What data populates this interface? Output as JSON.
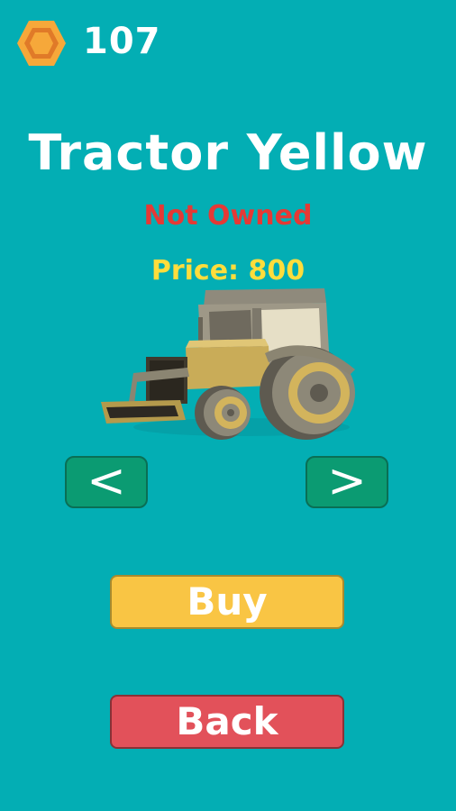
{
  "currency": {
    "icon": "hexagon-coin-icon",
    "amount": "107",
    "colors": {
      "outer": "#f6a83a",
      "inner": "#e07a28"
    }
  },
  "vehicle": {
    "name": "Tractor Yellow",
    "ownership_status": "Not Owned",
    "price_label": "Price: 800",
    "status_color": "#e53935",
    "price_color": "#ffdd3c"
  },
  "navigation": {
    "prev_label": "<",
    "next_label": ">",
    "button_color": "#0b9b72"
  },
  "actions": {
    "buy_label": "Buy",
    "back_label": "Back",
    "buy_color": "#f9c544",
    "back_color": "#e2515a"
  },
  "theme": {
    "background": "#03aeb4"
  }
}
